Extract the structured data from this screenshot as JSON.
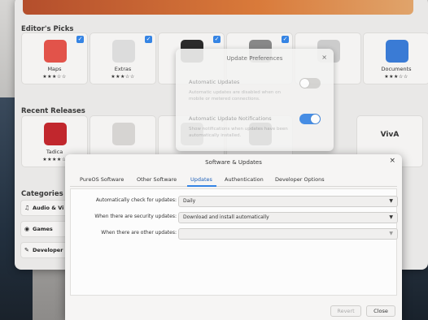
{
  "store": {
    "editors_picks_title": "Editor's Picks",
    "recent_releases_title": "Recent Releases",
    "categories_title": "Categories",
    "editors_picks": [
      {
        "name": "Maps",
        "stars": "★★★☆☆",
        "checked": true,
        "color": "#e2534a"
      },
      {
        "name": "Extras",
        "stars": "★★★☆☆",
        "checked": true,
        "color": "#dcdcdc"
      },
      {
        "name": "",
        "stars": "",
        "checked": true,
        "color": "#2b2b2b"
      },
      {
        "name": "",
        "stars": "",
        "checked": true,
        "color": "#888"
      },
      {
        "name": "",
        "stars": "",
        "checked": false,
        "color": "#ccc"
      },
      {
        "name": "Documents",
        "stars": "★★★☆☆",
        "checked": false,
        "color": "#3a7bd5"
      }
    ],
    "recent_releases": [
      {
        "name": "Tadica",
        "stars": "★★★★☆",
        "color": "#c1272d"
      },
      {
        "name": "",
        "stars": "",
        "color": "#d6d4d2"
      },
      {
        "name": "",
        "stars": "",
        "color": "#777"
      },
      {
        "name": "",
        "stars": "",
        "color": "#333"
      }
    ],
    "categories": [
      {
        "label": "Audio & Vi",
        "icon": "♫"
      },
      {
        "label": "Games",
        "icon": "🎮"
      },
      {
        "label": "Developer",
        "icon": "✎"
      }
    ],
    "recent_release_logo": "VivA"
  },
  "prefs": {
    "title": "Update Preferences",
    "close": "×",
    "auto_updates_label": "Automatic Updates",
    "auto_updates_desc": "Automatic updates are disabled when on mobile or metered connections.",
    "auto_updates_on": false,
    "notif_label": "Automatic Update Notifications",
    "notif_desc": "Show notifications when updates have been automatically installed.",
    "notif_on": true
  },
  "su": {
    "title": "Software & Updates",
    "close": "×",
    "tabs": [
      "PureOS Software",
      "Other Software",
      "Updates",
      "Authentication",
      "Developer Options"
    ],
    "active_tab": 2,
    "fields": [
      {
        "label": "Automatically check for updates:",
        "value": "Daily"
      },
      {
        "label": "When there are security updates:",
        "value": "Download and install automatically"
      },
      {
        "label": "When there are other updates:",
        "value": ""
      }
    ],
    "revert_label": "Revert",
    "close_label": "Close"
  },
  "colors": {
    "accent": "#3584e4",
    "toggle_off": "#d2d1cf"
  }
}
